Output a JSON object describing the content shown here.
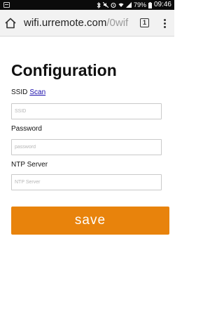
{
  "status_bar": {
    "battery_percent": "79%",
    "time": "09:46",
    "icons": [
      "notification-icon",
      "bluetooth-icon",
      "mute-icon",
      "alarm-icon",
      "wifi-icon",
      "signal-icon",
      "battery-icon"
    ]
  },
  "browser": {
    "url_host": "wifi.urremote.com",
    "url_path": "/0wif",
    "tab_count": "1"
  },
  "page": {
    "title": "Configuration",
    "ssid_label": "SSID",
    "scan_link": "Scan",
    "ssid_placeholder": "SSID",
    "ssid_value": "",
    "password_label": "Password",
    "password_placeholder": "password",
    "password_value": "",
    "ntp_label": "NTP Server",
    "ntp_placeholder": "NTP Server",
    "ntp_value": "",
    "save_label": "save"
  },
  "colors": {
    "accent": "#e8830c",
    "link": "#1a0dab",
    "status_bar": "#0b0b0b"
  }
}
